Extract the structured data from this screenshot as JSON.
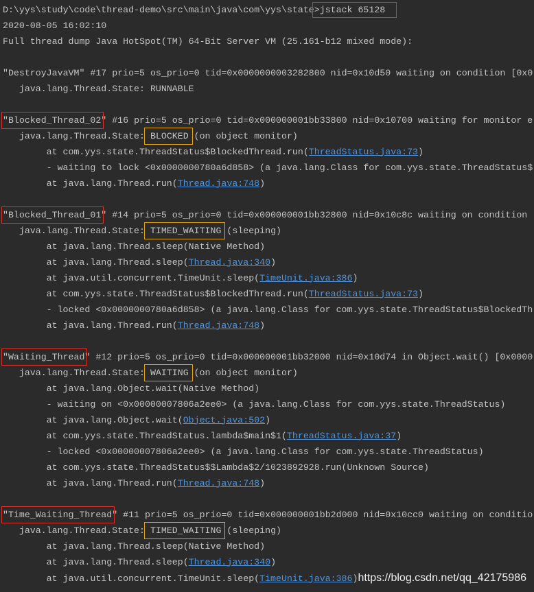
{
  "colors": {
    "background": "#2b2b2b",
    "text": "#c4c4c4",
    "link": "#4f95df",
    "highlight_red": "#e0302a",
    "highlight_yellow": "#e5a50a",
    "watermark": "#ffffff"
  },
  "terminal": {
    "prompt_path": "D:\\yys\\study\\code\\thread-demo\\src\\main\\java\\com\\yys\\state",
    "prompt_symbol": ">",
    "command": "jstack 65128",
    "timestamp": "2020-08-05 16:02:10",
    "dump_header": "Full thread dump Java HotSpot(TM) 64-Bit Server VM (25.161-b12 mixed mode):"
  },
  "threads": [
    {
      "name": "\"DestroyJavaVM\"",
      "info": " #17 prio=5 os_prio=0 tid=0x0000000003282800 nid=0x10d50 waiting on condition [0x0",
      "state_label": "java.lang.Thread.State: ",
      "state": "RUNNABLE"
    },
    {
      "name": "\"Blocked_Thread_02\"",
      "info": " #16 prio=5 os_prio=0 tid=0x000000001bb33800 nid=0x10700 waiting for monitor e",
      "state_label": "java.lang.Thread.State: ",
      "state": "BLOCKED",
      "state_detail": " (on object monitor)",
      "frames": [
        {
          "text": "at com.yys.state.ThreadStatus$BlockedThread.run(",
          "link": "ThreadStatus.java:73",
          "tail": ")"
        },
        {
          "text": "- waiting to lock <0x0000000780a6d858> (a java.lang.Class for com.yys.state.ThreadStatus$"
        },
        {
          "text": "at java.lang.Thread.run(",
          "link": "Thread.java:748",
          "tail": ")"
        }
      ]
    },
    {
      "name": "\"Blocked_Thread_01\"",
      "info": " #14 prio=5 os_prio=0 tid=0x000000001bb32800 nid=0x10c8c waiting on condition",
      "state_label": "java.lang.Thread.State: ",
      "state": "TIMED_WAITING",
      "state_detail": " (sleeping)",
      "frames": [
        {
          "text": "at java.lang.Thread.sleep(Native Method)"
        },
        {
          "text": "at java.lang.Thread.sleep(",
          "link": "Thread.java:340",
          "tail": ")"
        },
        {
          "text": "at java.util.concurrent.TimeUnit.sleep(",
          "link": "TimeUnit.java:386",
          "tail": ")"
        },
        {
          "text": "at com.yys.state.ThreadStatus$BlockedThread.run(",
          "link": "ThreadStatus.java:73",
          "tail": ")"
        },
        {
          "text": "- locked <0x0000000780a6d858> (a java.lang.Class for com.yys.state.ThreadStatus$BlockedTh"
        },
        {
          "text": "at java.lang.Thread.run(",
          "link": "Thread.java:748",
          "tail": ")"
        }
      ]
    },
    {
      "name": "\"Waiting_Thread\"",
      "info": " #12 prio=5 os_prio=0 tid=0x000000001bb32000 nid=0x10d74 in Object.wait() [0x0000",
      "state_label": "java.lang.Thread.State: ",
      "state": "WAITING",
      "state_detail": " (on object monitor)",
      "frames": [
        {
          "text": "at java.lang.Object.wait(Native Method)"
        },
        {
          "text": "- waiting on <0x00000007806a2ee0> (a java.lang.Class for com.yys.state.ThreadStatus)"
        },
        {
          "text": "at java.lang.Object.wait(",
          "link": "Object.java:502",
          "tail": ")"
        },
        {
          "text": "at com.yys.state.ThreadStatus.lambda$main$1(",
          "link": "ThreadStatus.java:37",
          "tail": ")"
        },
        {
          "text": "- locked <0x00000007806a2ee0> (a java.lang.Class for com.yys.state.ThreadStatus)"
        },
        {
          "text": "at com.yys.state.ThreadStatus$$Lambda$2/1023892928.run(Unknown Source)"
        },
        {
          "text": "at java.lang.Thread.run(",
          "link": "Thread.java:748",
          "tail": ")"
        }
      ]
    },
    {
      "name": "\"Time_Waiting_Thread\"",
      "info": " #11 prio=5 os_prio=0 tid=0x000000001bb2d000 nid=0x10cc0 waiting on conditio",
      "state_label": "java.lang.Thread.State: ",
      "state": "TIMED_WAITING",
      "state_detail": " (sleeping)",
      "frames": [
        {
          "text": "at java.lang.Thread.sleep(Native Method)"
        },
        {
          "text": "at java.lang.Thread.sleep(",
          "link": "Thread.java:340",
          "tail": ")"
        },
        {
          "text": "at java.util.concurrent.TimeUnit.sleep(",
          "link": "TimeUnit.java:386",
          "tail": ")"
        }
      ]
    }
  ],
  "watermark": "https://blog.csdn.net/qq_42175986"
}
